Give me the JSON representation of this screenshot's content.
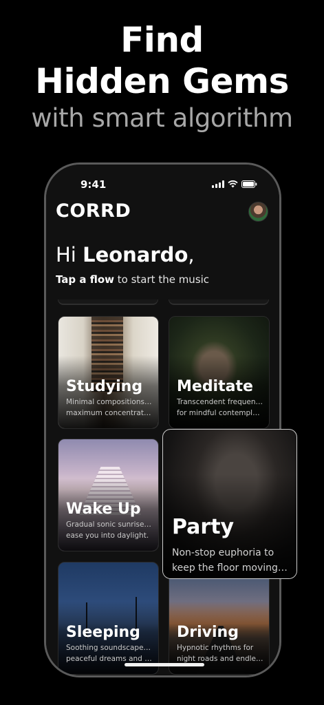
{
  "promo": {
    "title_line1": "Find",
    "title_line2": "Hidden Gems",
    "subtitle": "with smart algorithm"
  },
  "status_bar": {
    "time": "9:41",
    "icons": [
      "signal-icon",
      "wifi-icon",
      "battery-icon"
    ]
  },
  "app": {
    "logo": "CORRD",
    "greeting_prefix": "Hi ",
    "user_name": "Leonardo",
    "greeting_suffix": ",",
    "instruction_bold": "Tap a flow",
    "instruction_rest": " to start the music"
  },
  "flows": [
    {
      "title": "Studying",
      "desc_line1": "Minimal compositions for",
      "desc_line2": "maximum concentration."
    },
    {
      "title": "Meditate",
      "desc_line1": "Transcendent frequencies",
      "desc_line2": "for mindful contemplati..."
    },
    {
      "title": "Wake Up",
      "desc_line1": "Gradual sonic sunrise to",
      "desc_line2": "ease you into daylight."
    },
    {
      "title": "Party",
      "desc_line1": "Non-stop euphoria to",
      "desc_line2": "keep the floor moving u..."
    },
    {
      "title": "Sleeping",
      "desc_line1": "Soothing soundscapes for",
      "desc_line2": "peaceful dreams and de..."
    },
    {
      "title": "Driving",
      "desc_line1": "Hypnotic rhythms for",
      "desc_line2": "night roads and endless ..."
    }
  ],
  "colors": {
    "background": "#000000",
    "screen": "#111111",
    "subtitle": "#a7a7a7",
    "phone_frame": "#5a5a5a"
  }
}
